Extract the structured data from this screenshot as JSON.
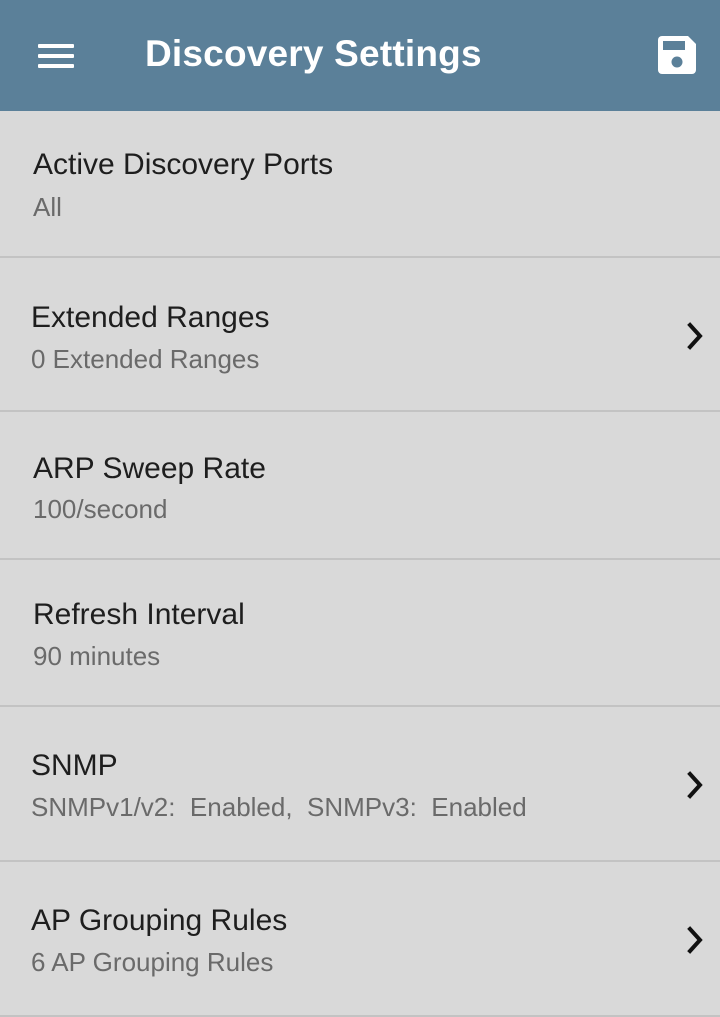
{
  "app_bar": {
    "title": "Discovery Settings",
    "menu_icon": "hamburger-menu-icon",
    "save_icon": "floppy-disk-save-icon",
    "background": "#5b8099"
  },
  "settings": [
    {
      "label": "Active Discovery Ports",
      "value": "All",
      "has_chevron": false
    },
    {
      "label": "Extended Ranges",
      "value": "0 Extended Ranges",
      "has_chevron": true
    },
    {
      "label": "ARP Sweep Rate",
      "value": "100/second",
      "has_chevron": false
    },
    {
      "label": "Refresh Interval",
      "value": "90 minutes",
      "has_chevron": false
    },
    {
      "label": "SNMP",
      "value": "SNMPv1/v2:  Enabled,  SNMPv3:  Enabled",
      "has_chevron": true
    },
    {
      "label": "AP Grouping Rules",
      "value": "6 AP Grouping Rules",
      "has_chevron": true
    }
  ]
}
